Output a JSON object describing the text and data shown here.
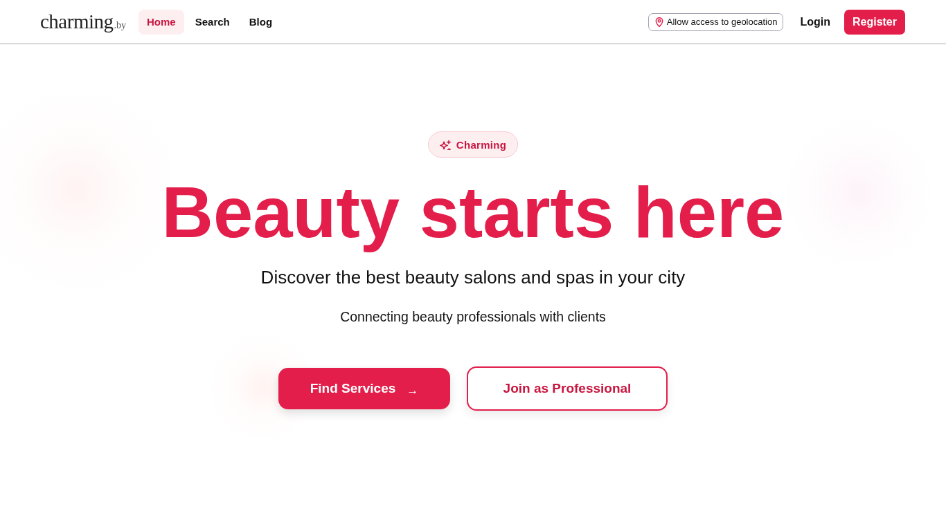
{
  "header": {
    "logo": {
      "name": "charming",
      "suffix": ".by"
    },
    "nav": [
      {
        "label": "Home",
        "selected": true
      },
      {
        "label": "Search",
        "selected": false
      },
      {
        "label": "Blog",
        "selected": false
      }
    ],
    "geolocation_button": {
      "label": "Allow access to geolocation"
    },
    "login": "Login",
    "register": "Register"
  },
  "hero": {
    "badge": "Charming",
    "heading": "Beauty starts here",
    "subtitle": "Discover the best beauty salons and spas in your city",
    "tagline": "Connecting beauty professionals with clients",
    "buttons": [
      {
        "label": "Find Services",
        "kind": "primary",
        "arrow": "→"
      },
      {
        "label": "Join as Professional",
        "kind": "outline"
      }
    ]
  }
}
